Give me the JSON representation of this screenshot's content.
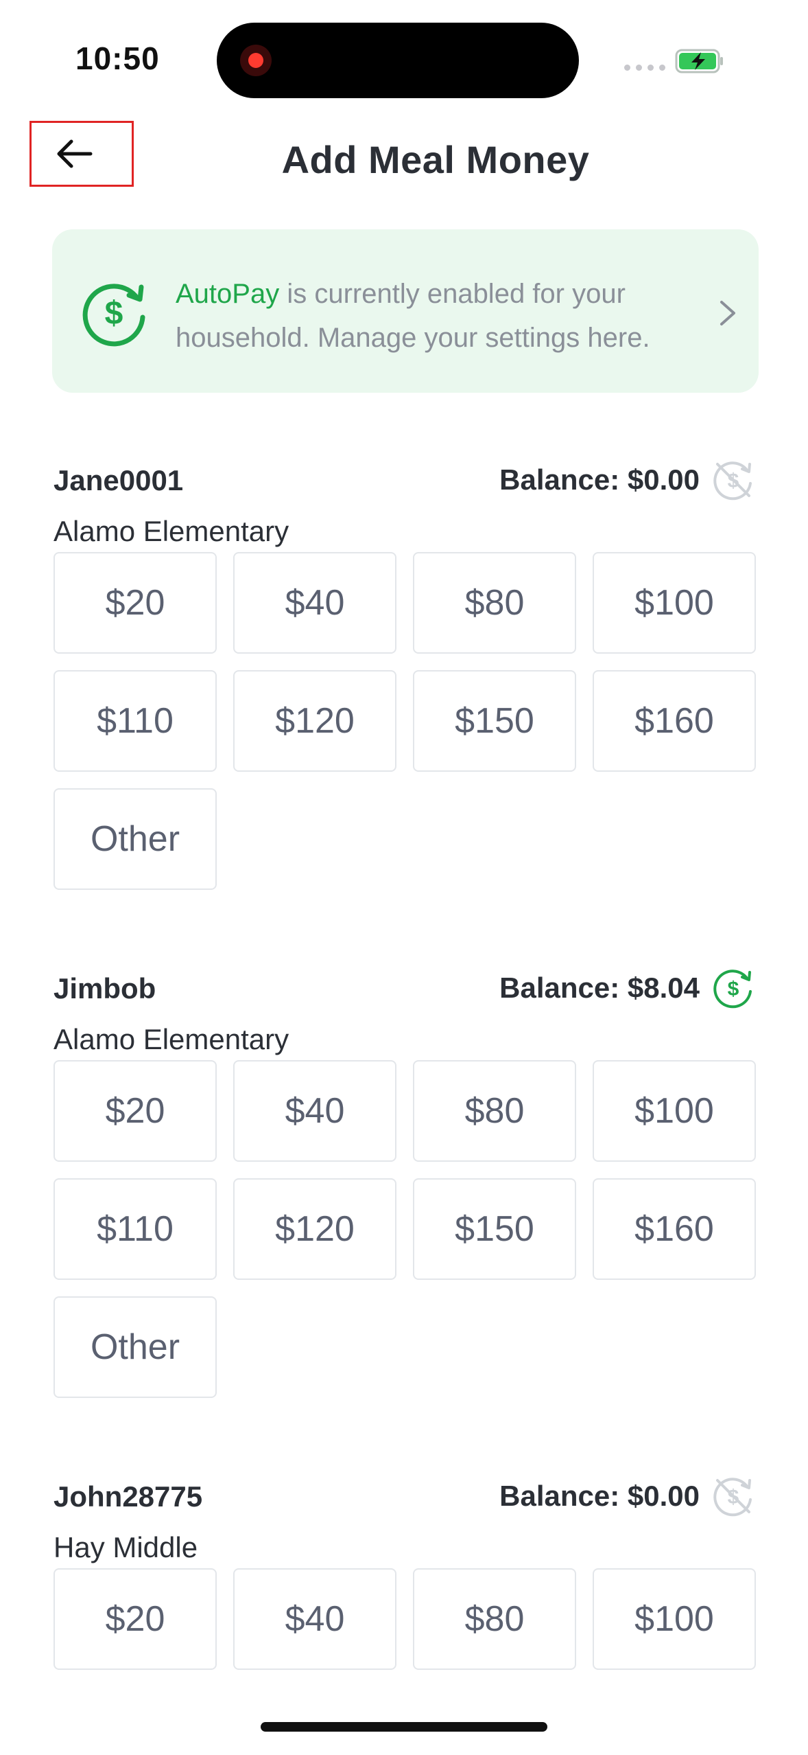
{
  "status_bar": {
    "time": "10:50"
  },
  "header": {
    "title": "Add Meal Money"
  },
  "autopay_banner": {
    "highlight": "AutoPay",
    "text": " is currently enabled for your household. Manage your settings here."
  },
  "students": [
    {
      "name": "Jane0001",
      "balance": "Balance: $0.00",
      "school": "Alamo Elementary",
      "autopay_icon": "autopay-off-icon",
      "amounts": [
        "$20",
        "$40",
        "$80",
        "$100",
        "$110",
        "$120",
        "$150",
        "$160",
        "Other"
      ]
    },
    {
      "name": "Jimbob",
      "balance": "Balance: $8.04",
      "school": "Alamo Elementary",
      "autopay_icon": "autopay-on-icon",
      "amounts": [
        "$20",
        "$40",
        "$80",
        "$100",
        "$110",
        "$120",
        "$150",
        "$160",
        "Other"
      ]
    },
    {
      "name": "John28775",
      "balance": "Balance: $0.00",
      "school": "Hay Middle",
      "autopay_icon": "autopay-off-icon",
      "amounts": [
        "$20",
        "$40",
        "$80",
        "$100"
      ]
    }
  ],
  "colors": {
    "accent_green": "#1fa64a",
    "banner_bg": "#eaf8ee",
    "highlight_border": "#e02424"
  }
}
